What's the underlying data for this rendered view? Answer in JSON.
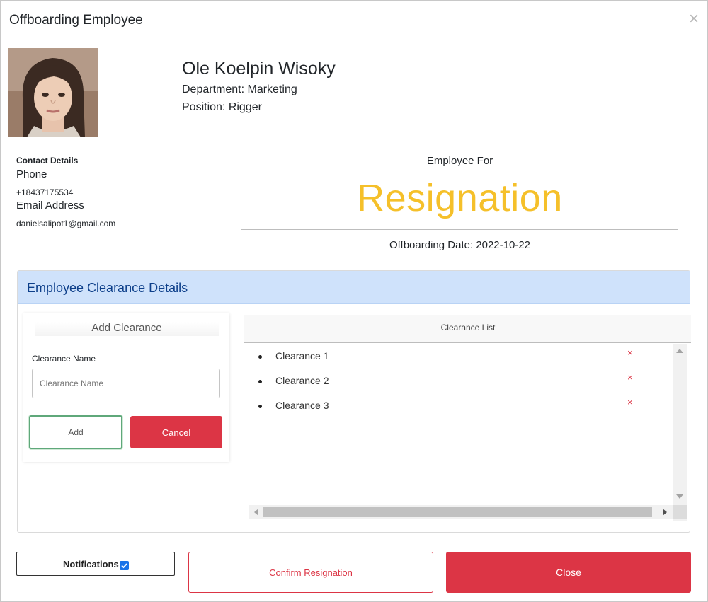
{
  "modal": {
    "title": "Offboarding Employee",
    "close_glyph": "×"
  },
  "employee": {
    "photo_icon": "employee-photo",
    "name": "Ole Koelpin Wisoky",
    "department": "Department: Marketing",
    "position": "Position: Rigger"
  },
  "contact": {
    "title": "Contact Details",
    "phone_label": "Phone",
    "phone": "+18437175534",
    "email_label": "Email Address",
    "email": "danielsalipot1@gmail.com"
  },
  "offboarding": {
    "for_label": "Employee For",
    "reason": "Resignation",
    "reason_color": "#f5c02a",
    "date": "Offboarding Date: 2022-10-22"
  },
  "clearance": {
    "section_title": "Employee Clearance Details",
    "add_title": "Add Clearance",
    "name_label": "Clearance Name",
    "name_placeholder": "Clearance Name",
    "name_value": "",
    "add_label": "Add",
    "cancel_label": "Cancel",
    "list_title": "Clearance List",
    "items": [
      {
        "label": "Clearance 1",
        "remove_glyph": "×"
      },
      {
        "label": "Clearance 2",
        "remove_glyph": "×"
      },
      {
        "label": "Clearance 3",
        "remove_glyph": "×"
      }
    ]
  },
  "footer": {
    "notifications_label": "Notifications",
    "notifications_checked": true,
    "confirm_label": "Confirm Resignation",
    "close_label": "Close"
  },
  "colors": {
    "danger": "#dc3545",
    "section_header_bg": "#cfe2fb",
    "section_header_text": "#0d3f8a",
    "checkbox": "#1a73e8"
  }
}
